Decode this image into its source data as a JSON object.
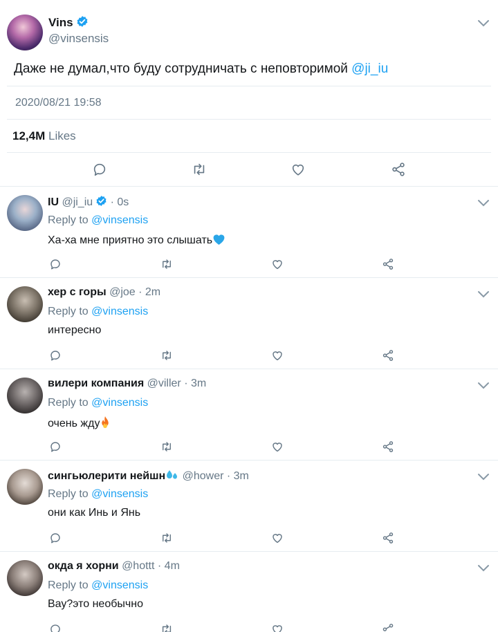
{
  "tweet": {
    "author_name": "Vins",
    "author_handle": "@vinsensis",
    "text": "Даже не думал,что буду сотрудничать с неповторимой ",
    "mention": "@ji_iu",
    "timestamp": "2020/08/21 19:58",
    "likes_count": "12,4M",
    "likes_label": "Likes"
  },
  "colors": {
    "accent": "#1da1f2",
    "muted": "#657786",
    "text": "#14171a",
    "divider": "#e6ecf0"
  },
  "replies": [
    {
      "name": "IU",
      "handle": "@ji_iu",
      "time": "· 0s",
      "verified": true,
      "reply_to_label": "Reply to ",
      "reply_to": "@vinsensis",
      "text": "Ха-ха мне приятно это слышать",
      "emoji": "blue-heart-icon"
    },
    {
      "name": "хер с горы",
      "handle": "@joe",
      "time": "· 2m",
      "reply_to_label": "Reply to ",
      "reply_to": "@vinsensis",
      "text": "интересно"
    },
    {
      "name": "вилери компания",
      "handle": "@viller",
      "time": "· 3m",
      "reply_to_label": "Reply to ",
      "reply_to": "@vinsensis",
      "text": "очень жду",
      "emoji": "fire-icon"
    },
    {
      "name": "сингьюлерити нейшн",
      "handle": "@hower",
      "time": "· 3m",
      "reply_to_label": "Reply to ",
      "reply_to": "@vinsensis",
      "text": "они как Инь и Янь",
      "name_emoji": "sweat-droplets-icon"
    },
    {
      "name": "окда я хорни",
      "handle": "@hottt",
      "time": "· 4m",
      "reply_to_label": "Reply to ",
      "reply_to": "@vinsensis",
      "text": "Вау?это необычно"
    }
  ]
}
